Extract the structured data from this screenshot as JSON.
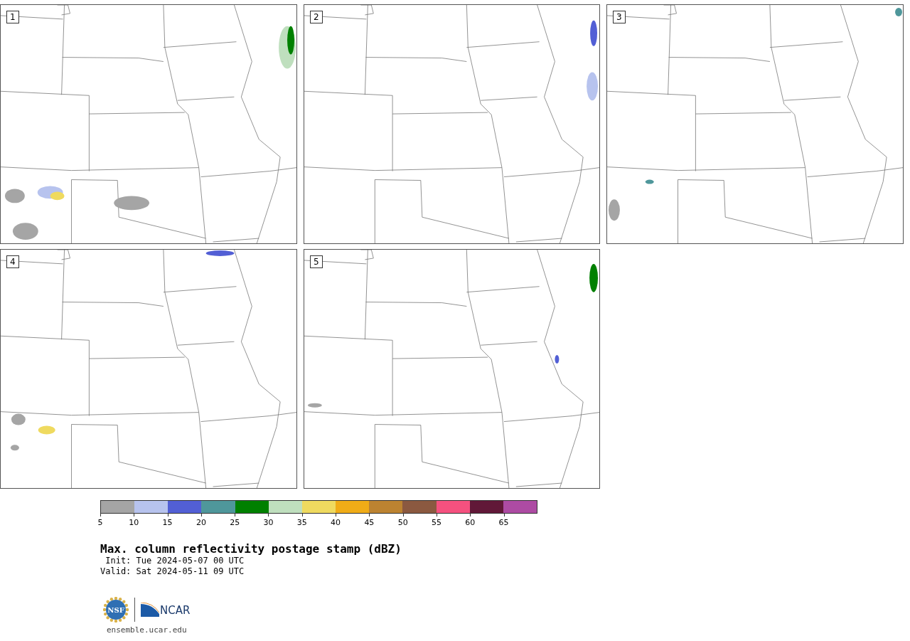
{
  "panels": [
    {
      "label": "1"
    },
    {
      "label": "2"
    },
    {
      "label": "3"
    },
    {
      "label": "4"
    },
    {
      "label": "5"
    }
  ],
  "colorbar": {
    "bins": [
      {
        "color": "#a5a5a5"
      },
      {
        "color": "#b7c3ee"
      },
      {
        "color": "#525fd5"
      },
      {
        "color": "#4f979b"
      },
      {
        "color": "#008000"
      },
      {
        "color": "#bfdfbe"
      },
      {
        "color": "#efda5f"
      },
      {
        "color": "#f0ac17"
      },
      {
        "color": "#bc8331"
      },
      {
        "color": "#8b5940"
      },
      {
        "color": "#f5517f"
      },
      {
        "color": "#611838"
      },
      {
        "color": "#ad4ba3"
      }
    ],
    "ticks": [
      "5",
      "10",
      "15",
      "20",
      "25",
      "30",
      "35",
      "40",
      "45",
      "50",
      "55",
      "60",
      "65"
    ]
  },
  "title": "Max. column reflectivity postage stamp (dBZ)",
  "init": " Init: Tue 2024-05-07 00 UTC",
  "valid": "Valid: Sat 2024-05-11 09 UTC",
  "logos": {
    "nsf": "NSF",
    "ncar": "NCAR"
  },
  "url": "ensemble.ucar.edu"
}
